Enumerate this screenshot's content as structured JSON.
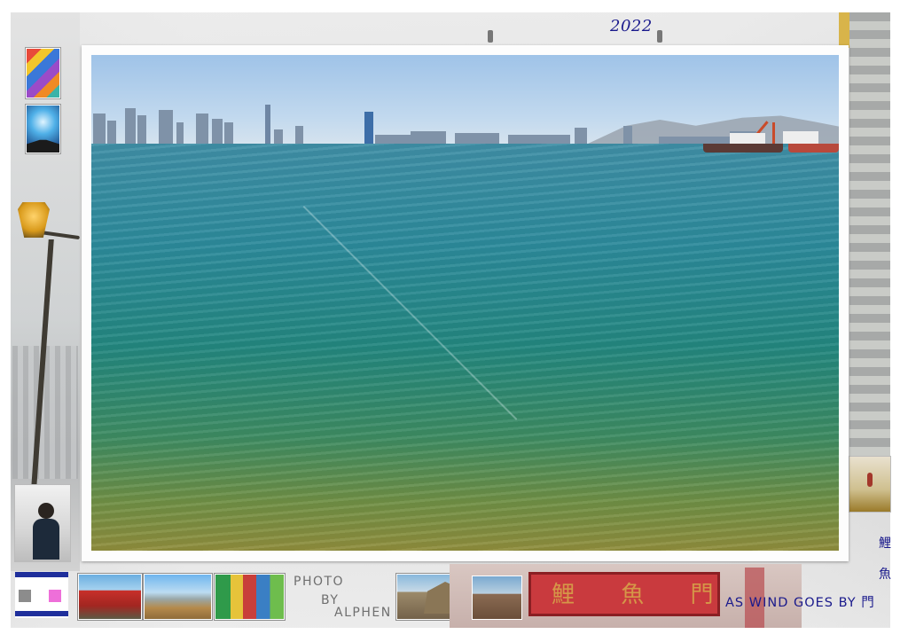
{
  "header": {
    "year": "2022"
  },
  "credits": {
    "line1": "PHOTO",
    "line2": "BY",
    "line3": "ALPHEN"
  },
  "sign": {
    "chars": "鯉 魚 門"
  },
  "tagline": {
    "text": "AS WIND GOES BY 門"
  },
  "vertical_label": {
    "chars": [
      "鯉",
      "魚"
    ]
  },
  "colors": {
    "accent_text": "#1a1a8c",
    "credit_text": "#6f6f6f",
    "flag_blue": "#1f2f9c",
    "flag_pink": "#ee6fd9",
    "flag_grey": "#8c8c8c"
  }
}
